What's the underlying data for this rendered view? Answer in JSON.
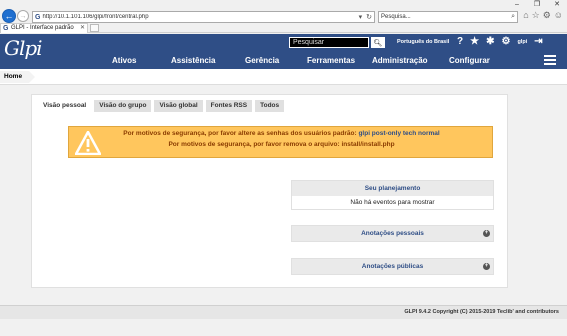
{
  "browser": {
    "address": "http://10.1.101.106/glpi/front/central.php",
    "search_placeholder": "Pesquisa...",
    "tab_title": "GLPI - Interface padrão"
  },
  "header": {
    "logo": "Glpi",
    "search_placeholder": "Pesquisar",
    "language": "Português do Brasil",
    "user": "glpi"
  },
  "menu": {
    "items": [
      "Ativos",
      "Assistência",
      "Gerência",
      "Ferramentas",
      "Administração",
      "Configurar"
    ]
  },
  "breadcrumb": {
    "home": "Home"
  },
  "tabs": [
    "Visão pessoal",
    "Visão do grupo",
    "Visão global",
    "Fontes RSS",
    "Todos"
  ],
  "warning": {
    "line1_text": "Por motivos de segurança, por favor altere as senhas dos usuários padrão:",
    "line1_users": "glpi post-only tech normal",
    "line2": "Por motivos de segurança, por favor remova o arquivo: install/install.php"
  },
  "planning": {
    "title": "Seu planejamento",
    "empty": "Não há eventos para mostrar"
  },
  "notes_personal": {
    "title": "Anotações pessoais"
  },
  "notes_public": {
    "title": "Anotações públicas"
  },
  "footer": {
    "text": "GLPI 9.4.2 Copyright (C) 2015-2019 Teclib' and contributors"
  },
  "colors": {
    "brand": "#2f4e86",
    "warning_bg": "#ffc65d",
    "warning_text": "#8a3b00"
  }
}
